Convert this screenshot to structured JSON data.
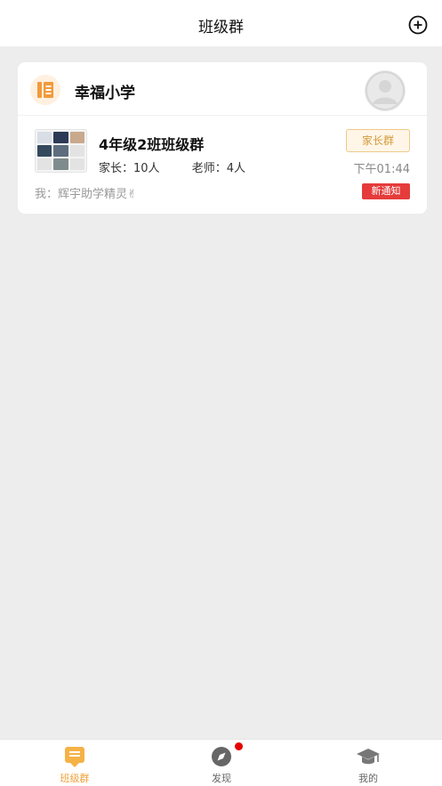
{
  "header": {
    "title": "班级群"
  },
  "school": {
    "name": "幸福小学"
  },
  "group": {
    "name": "4年级2班班级群",
    "parents_label": "家长：",
    "parents_count": "10人",
    "teachers_label": "老师：",
    "teachers_count": "4人",
    "badge": "家长群",
    "time": "下午01:44",
    "last_message": "我：辉宇助学精灵✌",
    "new_badge": "新通知"
  },
  "tabbar": {
    "items": [
      {
        "label": "班级群",
        "icon": "class-group-icon",
        "active": true
      },
      {
        "label": "发现",
        "icon": "compass-icon",
        "active": false,
        "has_dot": true
      },
      {
        "label": "我的",
        "icon": "graduation-cap-icon",
        "active": false
      }
    ]
  },
  "colors": {
    "accent": "#f0a03a",
    "badge_red": "#e63b3b",
    "background": "#ededed"
  }
}
